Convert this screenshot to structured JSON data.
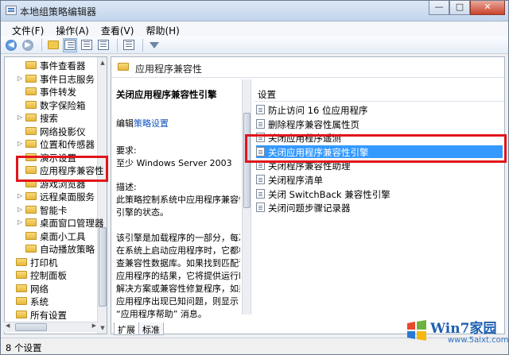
{
  "window": {
    "title": "本地组策略编辑器",
    "minimize": "—",
    "maximize": "□",
    "close": "✕"
  },
  "menu": [
    "文件(F)",
    "操作(A)",
    "查看(V)",
    "帮助(H)"
  ],
  "toolbar": {
    "back": "◀",
    "forward": "▶"
  },
  "tree": {
    "items": [
      {
        "label": "事件查看器",
        "expandable": false
      },
      {
        "label": "事件日志服务",
        "expandable": true
      },
      {
        "label": "事件转发",
        "expandable": false
      },
      {
        "label": "数字保险箱",
        "expandable": false
      },
      {
        "label": "搜索",
        "expandable": true
      },
      {
        "label": "网络投影仪",
        "expandable": false
      },
      {
        "label": "位置和传感器",
        "expandable": true
      },
      {
        "label": "演示设置",
        "expandable": false
      },
      {
        "label": "应用程序兼容性",
        "expandable": false,
        "selected": true
      },
      {
        "label": "游戏浏览器",
        "expandable": false
      },
      {
        "label": "远程桌面服务",
        "expandable": true
      },
      {
        "label": "智能卡",
        "expandable": true
      },
      {
        "label": "桌面窗口管理器",
        "expandable": true
      },
      {
        "label": "桌面小工具",
        "expandable": false
      },
      {
        "label": "自动播放策略",
        "expandable": false
      },
      {
        "label": "打印机",
        "expandable": false,
        "root": true
      },
      {
        "label": "控制面板",
        "expandable": false,
        "root": true
      },
      {
        "label": "网络",
        "expandable": false,
        "root": true
      },
      {
        "label": "系统",
        "expandable": false,
        "root": true
      },
      {
        "label": "所有设置",
        "expandable": false,
        "root": true
      }
    ]
  },
  "pane": {
    "header": "应用程序兼容性",
    "description": {
      "title": "关闭应用程序兼容性引擎",
      "edit_prefix": "编辑",
      "edit_link": "策略设置",
      "req_label": "要求:",
      "req_value": "至少 Windows Server 2003",
      "desc_label": "描述:",
      "desc_lines": [
        "此策略控制系统中应用程序兼容性",
        "引擎的状态。",
        "",
        "该引擎是加载程序的一部分，每次",
        "在系统上启动应用程序时，它都检",
        "查兼容性数据库。如果找到匹配该",
        "应用程序的结果，它将提供运行时",
        "解决方案或兼容性修复程序，如果",
        "应用程序出现已知问题，则显示",
        "“应用程序帮助” 消息。"
      ]
    },
    "list_header": "设置",
    "settings": [
      {
        "label": "防止访问 16 位应用程序",
        "selected": false
      },
      {
        "label": "删除程序兼容性属性页",
        "selected": false
      },
      {
        "label": "关闭应用程序遥测",
        "selected": false
      },
      {
        "label": "关闭应用程序兼容性引擎",
        "selected": true
      },
      {
        "label": "关闭程序兼容性助理",
        "selected": false
      },
      {
        "label": "关闭程序清单",
        "selected": false
      },
      {
        "label": "关闭 SwitchBack 兼容性引擎",
        "selected": false
      },
      {
        "label": "关闭问题步骤记录器",
        "selected": false
      }
    ],
    "tabs": [
      "扩展",
      "标准"
    ]
  },
  "status": {
    "text": "8 个设置"
  },
  "watermark": {
    "brand": "Win7家园",
    "url": "www.5aixt.com"
  },
  "colors": {
    "selection": "#3399ff",
    "highlight": "#e0151b",
    "link": "#0d52c1"
  }
}
